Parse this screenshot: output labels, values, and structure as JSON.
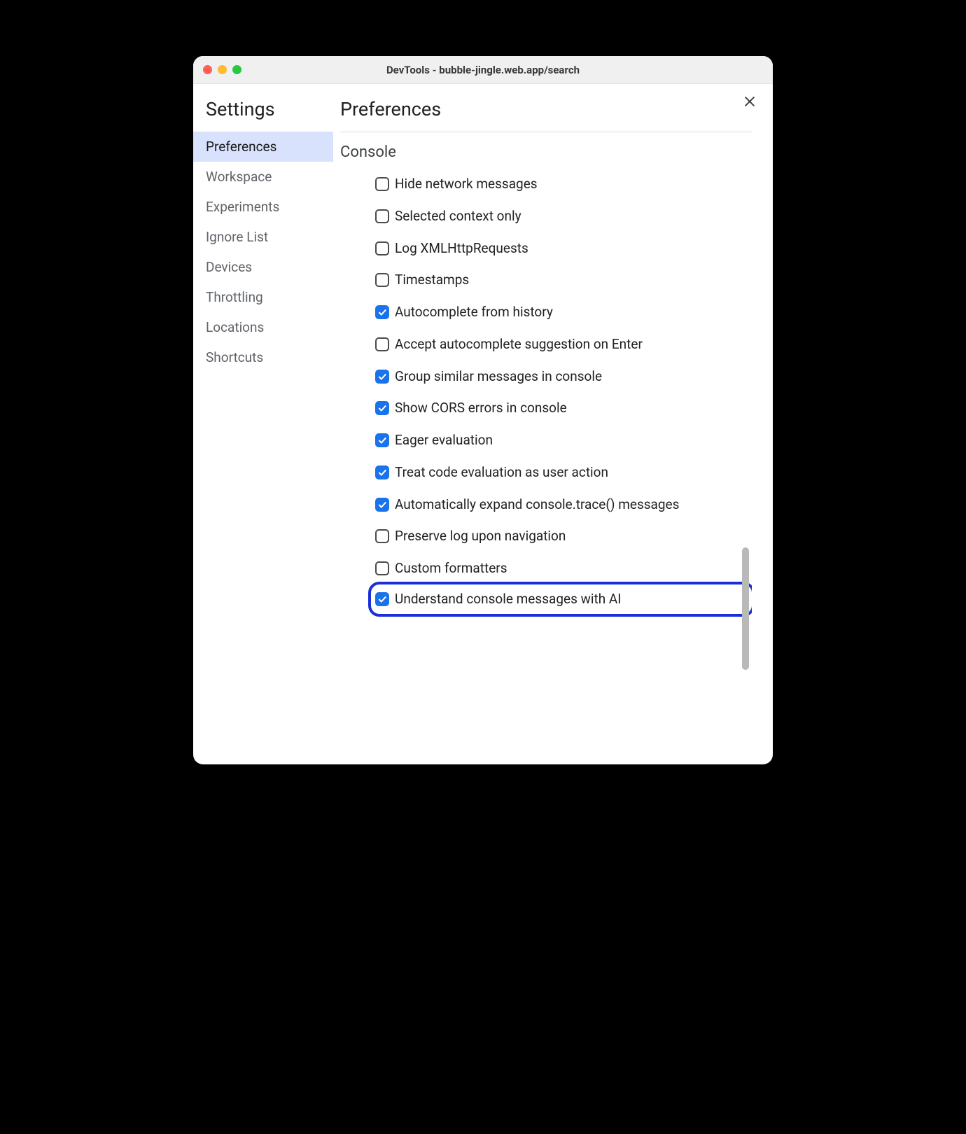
{
  "window": {
    "title": "DevTools - bubble-jingle.web.app/search"
  },
  "sidebar": {
    "title": "Settings",
    "items": [
      {
        "label": "Preferences",
        "selected": true
      },
      {
        "label": "Workspace",
        "selected": false
      },
      {
        "label": "Experiments",
        "selected": false
      },
      {
        "label": "Ignore List",
        "selected": false
      },
      {
        "label": "Devices",
        "selected": false
      },
      {
        "label": "Throttling",
        "selected": false
      },
      {
        "label": "Locations",
        "selected": false
      },
      {
        "label": "Shortcuts",
        "selected": false
      }
    ]
  },
  "main": {
    "title": "Preferences",
    "section": "Console",
    "options": [
      {
        "label": "Hide network messages",
        "checked": false,
        "highlight": false
      },
      {
        "label": "Selected context only",
        "checked": false,
        "highlight": false
      },
      {
        "label": "Log XMLHttpRequests",
        "checked": false,
        "highlight": false
      },
      {
        "label": "Timestamps",
        "checked": false,
        "highlight": false
      },
      {
        "label": "Autocomplete from history",
        "checked": true,
        "highlight": false
      },
      {
        "label": "Accept autocomplete suggestion on Enter",
        "checked": false,
        "highlight": false
      },
      {
        "label": "Group similar messages in console",
        "checked": true,
        "highlight": false
      },
      {
        "label": "Show CORS errors in console",
        "checked": true,
        "highlight": false
      },
      {
        "label": "Eager evaluation",
        "checked": true,
        "highlight": false
      },
      {
        "label": "Treat code evaluation as user action",
        "checked": true,
        "highlight": false
      },
      {
        "label": "Automatically expand console.trace() messages",
        "checked": true,
        "highlight": false
      },
      {
        "label": "Preserve log upon navigation",
        "checked": false,
        "highlight": false
      },
      {
        "label": "Custom formatters",
        "checked": false,
        "highlight": false
      },
      {
        "label": "Understand console messages with AI",
        "checked": true,
        "highlight": true
      }
    ]
  },
  "scrollbar": {
    "top_pct": 64,
    "height_pct": 21
  }
}
